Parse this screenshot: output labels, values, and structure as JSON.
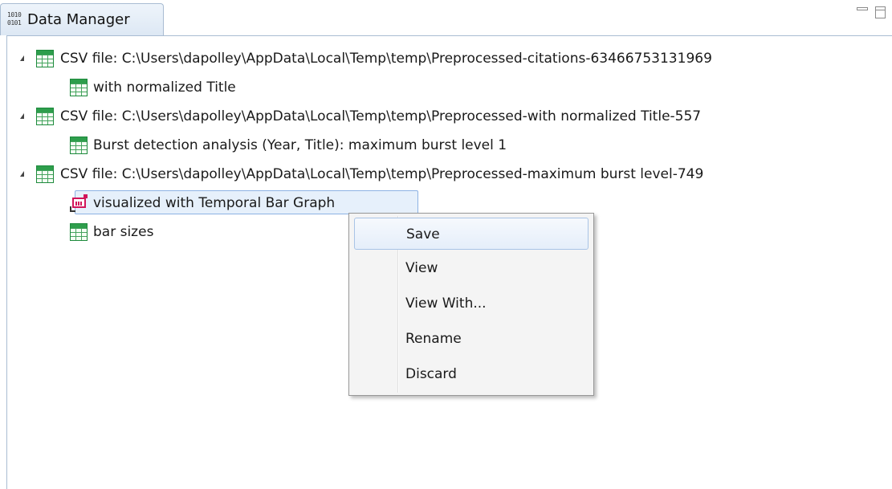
{
  "window": {
    "tab_title": "Data Manager",
    "tab_icon_lines": [
      "1010",
      "0101"
    ],
    "minimize_icon": "minimize-icon",
    "maximize_icon": "maximize-icon"
  },
  "tree": {
    "items": [
      {
        "level": 0,
        "icon": "table-icon",
        "expanded": true,
        "label": "CSV file: C:\\Users\\dapolley\\AppData\\Local\\Temp\\temp\\Preprocessed-citations-63466753131969"
      },
      {
        "level": 1,
        "icon": "table-icon",
        "label": "with normalized Title"
      },
      {
        "level": 0,
        "icon": "table-icon",
        "expanded": true,
        "label": "CSV file: C:\\Users\\dapolley\\AppData\\Local\\Temp\\temp\\Preprocessed-with normalized Title-557"
      },
      {
        "level": 1,
        "icon": "table-icon",
        "label": "Burst detection analysis (Year, Title): maximum burst level 1"
      },
      {
        "level": 0,
        "icon": "table-icon",
        "expanded": true,
        "label": "CSV file: C:\\Users\\dapolley\\AppData\\Local\\Temp\\temp\\Preprocessed-maximum burst level-749"
      },
      {
        "level": 1,
        "icon": "visualization-icon",
        "selected": true,
        "label": "visualized with Temporal Bar Graph"
      },
      {
        "level": 1,
        "icon": "table-icon",
        "label": "bar sizes"
      }
    ]
  },
  "context_menu": {
    "items": [
      {
        "label": "Save",
        "highlighted": true
      },
      {
        "label": "View"
      },
      {
        "label": "View With..."
      },
      {
        "label": "Rename"
      },
      {
        "label": "Discard"
      }
    ]
  },
  "colors": {
    "table_icon": "#2e9e4c",
    "visualization_icon": "#d1145a",
    "selection": "#e6f0fb",
    "tab_border": "#a9bcd2"
  }
}
